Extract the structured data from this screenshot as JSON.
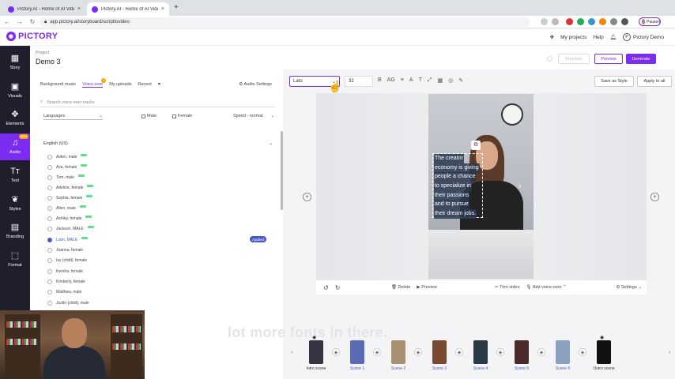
{
  "browser": {
    "tabs": [
      {
        "title": "Pictory.AI - Home of AI Video E...",
        "close": "×"
      },
      {
        "title": "Pictory.AI - Home of AI Video E...",
        "close": "×"
      }
    ],
    "new_tab": "+",
    "url": "app.pictory.ai/storyboard/scripttovideo",
    "paused_label": "Paused"
  },
  "header": {
    "brand": "PICTORY",
    "my_projects": "My projects",
    "help": "Help",
    "profile": "Pictory Demo",
    "profile_initial": "P"
  },
  "project": {
    "label": "Project",
    "name": "Demo 3",
    "previous": "Previous",
    "preview": "Preview",
    "generate": "Generate"
  },
  "leftnav": [
    {
      "label": "Story",
      "icon": "▦"
    },
    {
      "label": "Visuals",
      "icon": "▣"
    },
    {
      "label": "Elements",
      "icon": "✥"
    },
    {
      "label": "Audio",
      "icon": "♫",
      "badge": "NEW"
    },
    {
      "label": "Text",
      "icon": "Tт"
    },
    {
      "label": "Styles",
      "icon": "❦"
    },
    {
      "label": "Branding",
      "icon": "▤"
    },
    {
      "label": "Format",
      "icon": "⬚"
    }
  ],
  "audio_panel": {
    "tabs": [
      "Background music",
      "Voice-over",
      "My uploads",
      "Recent"
    ],
    "voiceover_badge": "1",
    "audio_settings": "Audio Settings",
    "search_placeholder": "Search voice-over tracks",
    "languages": "Languages",
    "male": "Male",
    "female": "Female",
    "speed": "Speed - normal",
    "group": "English (US)",
    "voices": [
      "Aiden, male",
      "Ava, female",
      "Tom, male",
      "Adeline, female",
      "Sophia, female",
      "Allen, male",
      "Ashley, female",
      "Jackson, MALE",
      "Liam, MALE",
      "Joanna, female",
      "Ivy (child), female",
      "Kendra, female",
      "Kimberly, female",
      "Matthew, male",
      "Justin (child), male"
    ],
    "applied": "Applied"
  },
  "toolbar": {
    "font": "Lato",
    "size": "32",
    "icons": [
      "B",
      "AG",
      "≡",
      "A",
      "T",
      "⤢",
      "▦",
      "◎",
      "✎"
    ],
    "save_style": "Save as Style",
    "apply_all": "Apply to all"
  },
  "caption_lines": [
    "The creator",
    "economy is giving",
    "people a chance",
    "to specialize in",
    "their passions",
    "and to pursue",
    "their dream jobs."
  ],
  "video_controls": {
    "delete": "Delete",
    "preview": "Preview",
    "trim": "Trim video",
    "add_voiceover": "Add voice-over",
    "settings": "Settings"
  },
  "subtitle_overlay": "lot more fonts in there.",
  "timeline": {
    "scenes": [
      "Intro scene",
      "Scene 1",
      "Scene 2",
      "Scene 3",
      "Scene 4",
      "Scene 5",
      "Scene 6",
      "Outro scene"
    ]
  },
  "colors": {
    "accent": "#7b2cf0",
    "nav_bg": "#1e1e2d",
    "applied": "#4a58c8"
  }
}
